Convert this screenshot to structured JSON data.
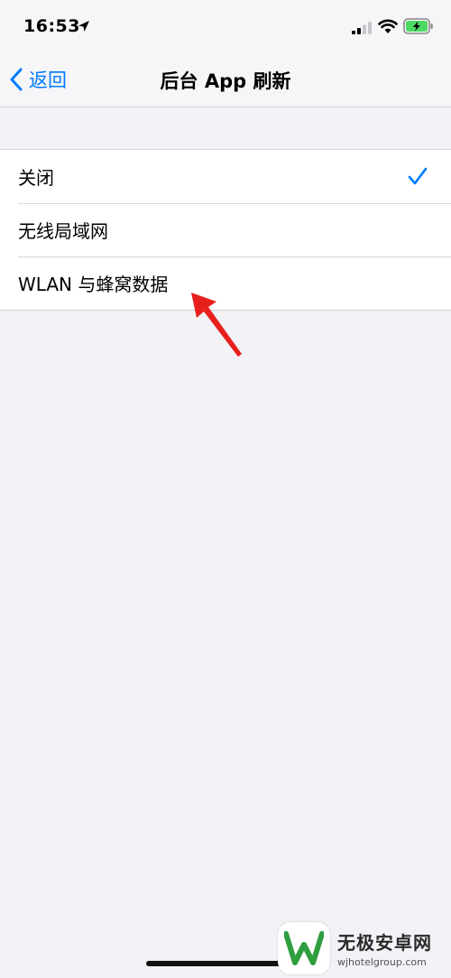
{
  "status_bar": {
    "time": "16:53"
  },
  "nav": {
    "back_label": "返回",
    "title": "后台 App 刷新"
  },
  "options": [
    {
      "label": "关闭",
      "selected": true
    },
    {
      "label": "无线局域网",
      "selected": false
    },
    {
      "label": "WLAN 与蜂窝数据",
      "selected": false
    }
  ],
  "colors": {
    "accent": "#007aff",
    "background": "#f2f2f7",
    "annotation_arrow": "#e8201d",
    "battery_fill": "#4cd964"
  },
  "watermark": {
    "name": "无极安卓网",
    "url": "wjhotelgroup.com"
  }
}
